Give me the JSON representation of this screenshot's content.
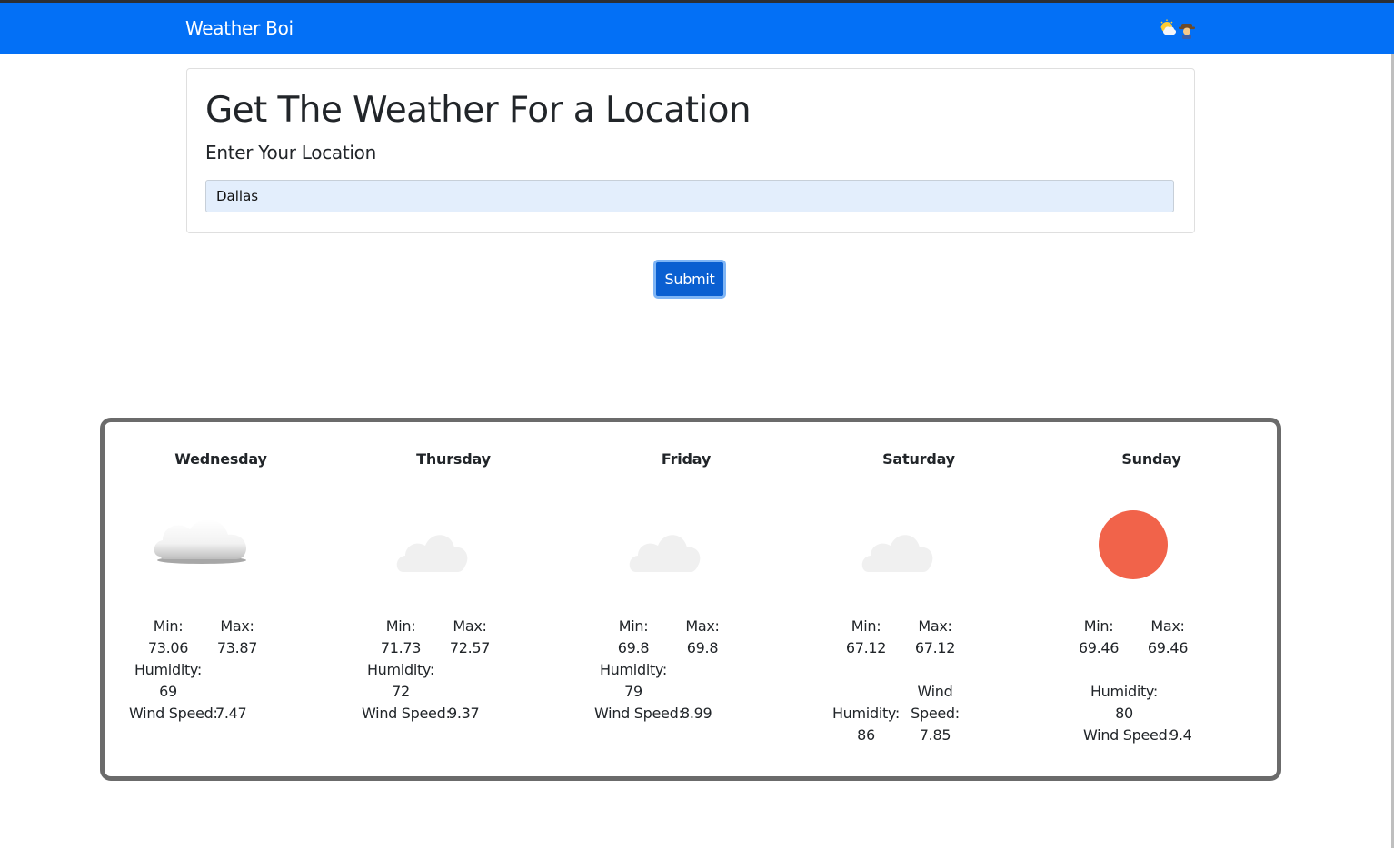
{
  "navbar": {
    "brand": "Weather Boi",
    "emoji_icons": [
      "sun-behind-cloud-icon",
      "cowboy-icon"
    ]
  },
  "form": {
    "title": "Get The Weather For a Location",
    "label": "Enter Your Location",
    "location_value": "Dallas",
    "submit_label": "Submit"
  },
  "forecast": {
    "days": [
      {
        "name": "Wednesday",
        "icon": "cloud-icon",
        "min_label": "Min:",
        "min": "73.06",
        "max_label": "Max:",
        "max": "73.87",
        "humidity_label": "Humidity:",
        "humidity": "69",
        "wind_label": "Wind Speed:",
        "wind": "7.47"
      },
      {
        "name": "Thursday",
        "icon": "light-cloud-icon",
        "min_label": "Min:",
        "min": "71.73",
        "max_label": "Max:",
        "max": "72.57",
        "humidity_label": "Humidity:",
        "humidity": "72",
        "wind_label": "Wind Speed:",
        "wind": "9.37"
      },
      {
        "name": "Friday",
        "icon": "light-cloud-icon",
        "min_label": "Min:",
        "min": "69.8",
        "max_label": "Max:",
        "max": "69.8",
        "humidity_label": "Humidity:",
        "humidity": "79",
        "wind_label": "Wind Speed:",
        "wind": "8.99"
      },
      {
        "name": "Saturday",
        "icon": "light-cloud-icon",
        "min_label": "Min:",
        "min": "67.12",
        "max_label": "Max:",
        "max": "67.12",
        "humidity_label": "Humidity:",
        "humidity": "86",
        "wind_label": "Wind Speed:",
        "wind_label_top": "Wind",
        "wind_label_bottom": "Speed:",
        "wind": "7.85"
      },
      {
        "name": "Sunday",
        "icon": "sun-icon",
        "min_label": "Min:",
        "min": "69.46",
        "max_label": "Max:",
        "max": "69.46",
        "humidity_label": "Humidity:",
        "humidity": "80",
        "wind_label": "Wind Speed:",
        "wind": "9.4"
      }
    ]
  },
  "colors": {
    "navbar": "#0370f6",
    "button": "#0a5fd1",
    "input_bg": "#e3eefc",
    "sun": "#f1634a",
    "panel_border": "#6b6b6b"
  }
}
